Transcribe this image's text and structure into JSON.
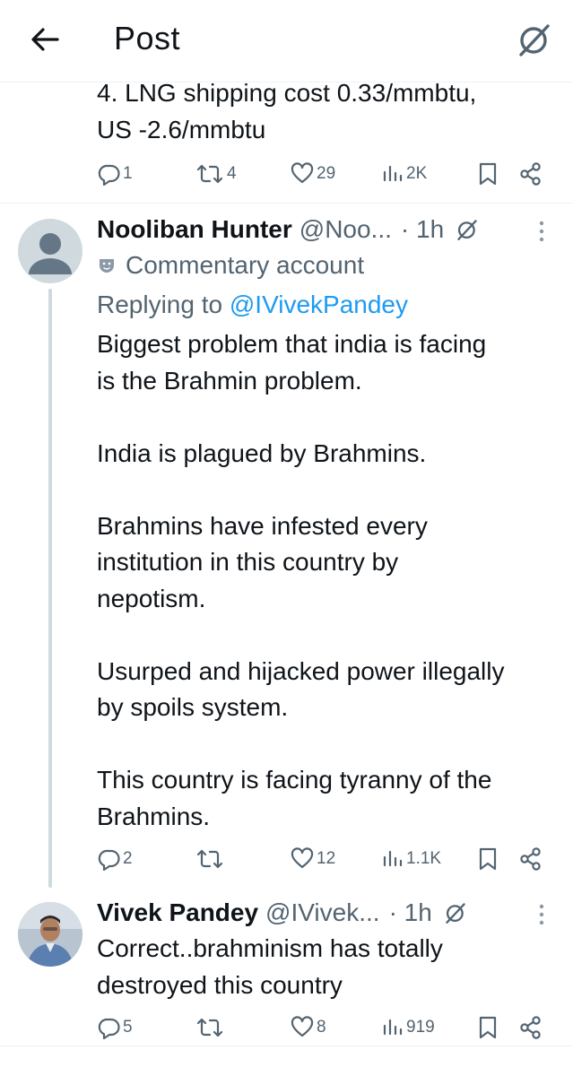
{
  "header": {
    "title": "Post",
    "back_icon": "arrow-left-icon",
    "grok_icon": "grok-icon"
  },
  "tweets": [
    {
      "text": "4. LNG shipping cost 0.33/mmbtu,\nUS -2.6/mmbtu",
      "stats": {
        "replies": "1",
        "reposts": "4",
        "likes": "29",
        "views": "2K"
      }
    },
    {
      "author": {
        "name": "Nooliban Hunter",
        "handle": "@Noo...",
        "time": "· 1h",
        "label": "Commentary account",
        "avatar": "default-avatar-icon"
      },
      "replying_prefix": "Replying to",
      "replying_to": "@IVivekPandey",
      "text": "Biggest problem that india is facing\nis the Brahmin problem.\n\nIndia is plagued by Brahmins.\n\nBrahmins have infested every\ninstitution in this country by\nnepotism.\n\nUsurped and hijacked power illegally\nby spoils system.\n\nThis country is facing tyranny of the\nBrahmins.",
      "stats": {
        "replies": "2",
        "reposts": "",
        "likes": "12",
        "views": "1.1K"
      }
    },
    {
      "author": {
        "name": "Vivek Pandey",
        "handle": "@IVivek...",
        "time": "· 1h",
        "avatar": "user-photo-avatar"
      },
      "text": "Correct..brahminism has totally\ndestroyed this country",
      "stats": {
        "replies": "5",
        "reposts": "",
        "likes": "8",
        "views": "919"
      }
    }
  ],
  "colors": {
    "text": "#0f1419",
    "secondary": "#536471",
    "link": "#1d9bf0",
    "divider": "#eff3f4",
    "thread_line": "#cfd9de"
  }
}
